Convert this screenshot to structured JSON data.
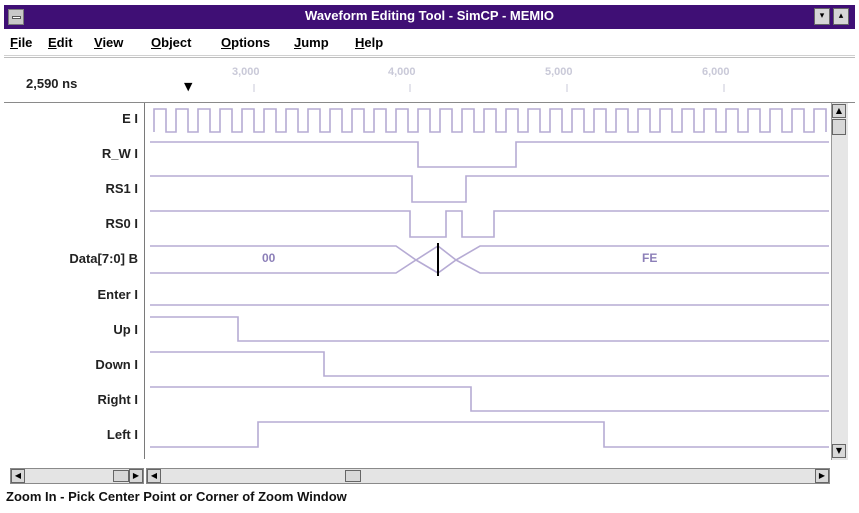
{
  "window": {
    "title": "Waveform Editing Tool - SimCP - MEMIO",
    "buttons": {
      "minimize": "▾",
      "maximize": "▴"
    }
  },
  "menu": [
    "File",
    "Edit",
    "View",
    "Object",
    "Options",
    "Jump",
    "Help"
  ],
  "ruler": {
    "current_time": "2,590 ns",
    "ticks": [
      "3,000",
      "4,000",
      "5,000",
      "6,000"
    ]
  },
  "signals": [
    {
      "name": "E",
      "type": "I"
    },
    {
      "name": "R_W",
      "type": "I"
    },
    {
      "name": "RS1",
      "type": "I"
    },
    {
      "name": "RS0",
      "type": "I"
    },
    {
      "name": "Data[7:0]",
      "type": "B"
    },
    {
      "name": "Enter",
      "type": "I"
    },
    {
      "name": "Up",
      "type": "I"
    },
    {
      "name": "Down",
      "type": "I"
    },
    {
      "name": "Right",
      "type": "I"
    },
    {
      "name": "Left",
      "type": "I"
    }
  ],
  "bus_values": {
    "data_left": "00",
    "data_right": "FE"
  },
  "colors": {
    "title_bar": "#3f0f75",
    "waveform": "#b6abd4",
    "bus_text": "#8c7fb8"
  },
  "status_text": "Zoom In - Pick Center Point or Corner of Zoom Window"
}
